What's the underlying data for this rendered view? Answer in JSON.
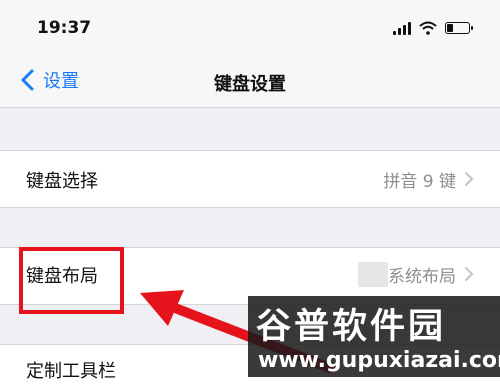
{
  "status_bar": {
    "time": "19:37"
  },
  "nav": {
    "back_label": "设置",
    "title": "键盘设置"
  },
  "settings": [
    {
      "label": "键盘选择",
      "value": "拼音 9 键"
    },
    {
      "label": "键盘布局",
      "value": "系统布局"
    },
    {
      "label": "定制工具栏",
      "value": ""
    }
  ],
  "watermark": {
    "brand": "谷普软件园",
    "url": "www.gupuxiazai.com"
  },
  "colors": {
    "accent": "#1a7cf5",
    "highlight": "#e5141c",
    "background": "#efeff4"
  }
}
